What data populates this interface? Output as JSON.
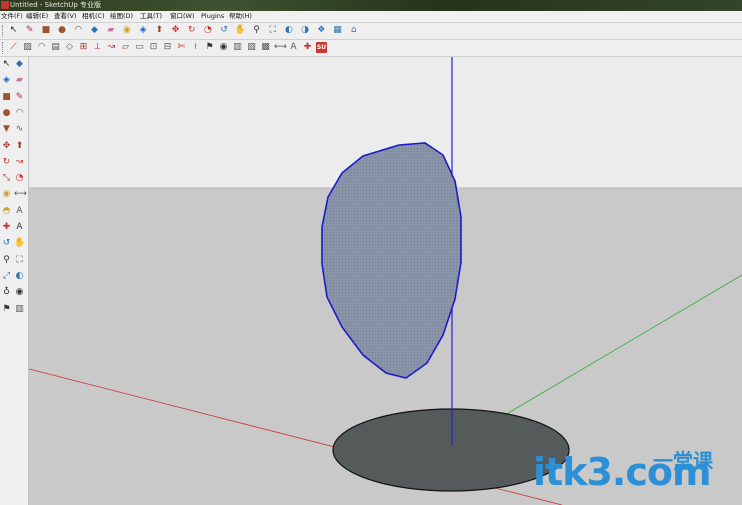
{
  "window": {
    "title": "Untitled - SketchUp 专业版"
  },
  "menu": [
    "文件(F)",
    "编辑(E)",
    "查看(V)",
    "相机(C)",
    "绘图(D)",
    "工具(T)",
    "窗口(W)",
    "Plugins",
    "帮助(H)"
  ],
  "toolbar_row1": [
    {
      "name": "select-arrow-icon",
      "glyph": "↖",
      "color": "#222222"
    },
    {
      "name": "pencil-line-icon",
      "glyph": "✎",
      "color": "#b03030"
    },
    {
      "name": "rectangle-icon",
      "glyph": "■",
      "color": "#a0522d"
    },
    {
      "name": "circle-icon",
      "glyph": "●",
      "color": "#a0522d"
    },
    {
      "name": "arc-icon",
      "glyph": "◠",
      "color": "#555555"
    },
    {
      "name": "make-component-icon",
      "glyph": "◆",
      "color": "#3070b0"
    },
    {
      "name": "eraser-icon",
      "glyph": "▰",
      "color": "#d070a0"
    },
    {
      "name": "tape-measure-icon",
      "glyph": "◉",
      "color": "#d0a030"
    },
    {
      "name": "paint-bucket-icon",
      "glyph": "◈",
      "color": "#2060c0"
    },
    {
      "name": "push-pull-icon",
      "glyph": "⬆",
      "color": "#a04020"
    },
    {
      "name": "move-icon",
      "glyph": "✥",
      "color": "#c03030"
    },
    {
      "name": "rotate-icon",
      "glyph": "↻",
      "color": "#c03030"
    },
    {
      "name": "offset-icon",
      "glyph": "◔",
      "color": "#c03030"
    },
    {
      "name": "orbit-icon",
      "glyph": "↺",
      "color": "#3070b0"
    },
    {
      "name": "pan-icon",
      "glyph": "✋",
      "color": "#3070b0"
    },
    {
      "name": "zoom-icon",
      "glyph": "⚲",
      "color": "#333333"
    },
    {
      "name": "zoom-extents-icon",
      "glyph": "⛶",
      "color": "#333333"
    },
    {
      "name": "previous-view-icon",
      "glyph": "◐",
      "color": "#3070b0"
    },
    {
      "name": "next-view-icon",
      "glyph": "◑",
      "color": "#3070b0"
    },
    {
      "name": "components-icon",
      "glyph": "❖",
      "color": "#3070b0"
    },
    {
      "name": "materials-icon",
      "glyph": "▦",
      "color": "#3070b0"
    },
    {
      "name": "warehouse-icon",
      "glyph": "⌂",
      "color": "#3070b0"
    }
  ],
  "toolbar_row2": [
    {
      "name": "sandbox-contours-icon",
      "glyph": "⟋",
      "color": "#b03030"
    },
    {
      "name": "sandbox-scratch-icon",
      "glyph": "▨",
      "color": "#555555"
    },
    {
      "name": "sandbox-smoove-icon",
      "glyph": "◠",
      "color": "#555555"
    },
    {
      "name": "sandbox-stamp-icon",
      "glyph": "▤",
      "color": "#555555"
    },
    {
      "name": "sandbox-drape-icon",
      "glyph": "◇",
      "color": "#555555"
    },
    {
      "name": "sandbox-add-detail-icon",
      "glyph": "⊞",
      "color": "#b03030"
    },
    {
      "name": "sandbox-flip-edge-icon",
      "glyph": "⟂",
      "color": "#b03030"
    },
    {
      "name": "follow-me-icon",
      "glyph": "↝",
      "color": "#b03030"
    },
    {
      "name": "intersect-icon",
      "glyph": "▱",
      "color": "#b03030"
    },
    {
      "name": "outer-shell-icon",
      "glyph": "▭",
      "color": "#555555"
    },
    {
      "name": "union-icon",
      "glyph": "⊡",
      "color": "#555555"
    },
    {
      "name": "subtract-icon",
      "glyph": "⊟",
      "color": "#555555"
    },
    {
      "name": "trim-icon",
      "glyph": "✄",
      "color": "#b03030"
    },
    {
      "name": "split-icon",
      "glyph": "⟊",
      "color": "#b03030"
    },
    {
      "name": "walk-icon",
      "glyph": "⚑",
      "color": "#333333"
    },
    {
      "name": "look-around-icon",
      "glyph": "◉",
      "color": "#333333"
    },
    {
      "name": "section-plane-icon",
      "glyph": "▥",
      "color": "#555555"
    },
    {
      "name": "section-cut-icon",
      "glyph": "▧",
      "color": "#555555"
    },
    {
      "name": "section-display-icon",
      "glyph": "▩",
      "color": "#555555"
    },
    {
      "name": "dimension-icon",
      "glyph": "⟷",
      "color": "#555555"
    },
    {
      "name": "text-label-icon",
      "glyph": "A",
      "color": "#555555"
    },
    {
      "name": "axes-icon",
      "glyph": "✚",
      "color": "#c03030"
    },
    {
      "name": "su-app-icon",
      "glyph": "SU",
      "color": "#ffffff",
      "bg": "#c8362d"
    }
  ],
  "side_toolbar": [
    {
      "name": "select-arrow-icon",
      "glyph": "↖",
      "color": "#222222"
    },
    {
      "name": "make-component-icon",
      "glyph": "◆",
      "color": "#3070b0"
    },
    {
      "name": "paint-bucket-icon",
      "glyph": "◈",
      "color": "#2060c0"
    },
    {
      "name": "eraser-icon",
      "glyph": "▰",
      "color": "#d070a0"
    },
    {
      "name": "rectangle-icon",
      "glyph": "■",
      "color": "#a0522d"
    },
    {
      "name": "pencil-line-icon",
      "glyph": "✎",
      "color": "#b03030"
    },
    {
      "name": "circle-icon",
      "glyph": "●",
      "color": "#a0522d"
    },
    {
      "name": "arc-icon",
      "glyph": "◠",
      "color": "#555555"
    },
    {
      "name": "polygon-icon",
      "glyph": "▼",
      "color": "#a0522d"
    },
    {
      "name": "freehand-icon",
      "glyph": "∿",
      "color": "#555555"
    },
    {
      "name": "move-icon",
      "glyph": "✥",
      "color": "#c03030"
    },
    {
      "name": "push-pull-icon",
      "glyph": "⬆",
      "color": "#a04020"
    },
    {
      "name": "rotate-icon",
      "glyph": "↻",
      "color": "#c03030"
    },
    {
      "name": "follow-me-icon",
      "glyph": "↝",
      "color": "#c03030"
    },
    {
      "name": "scale-icon",
      "glyph": "⤡",
      "color": "#c03030"
    },
    {
      "name": "offset-icon",
      "glyph": "◔",
      "color": "#c03030"
    },
    {
      "name": "tape-measure-icon",
      "glyph": "◉",
      "color": "#d0a030"
    },
    {
      "name": "dimension-icon",
      "glyph": "⟷",
      "color": "#555555"
    },
    {
      "name": "protractor-icon",
      "glyph": "◓",
      "color": "#d0a030"
    },
    {
      "name": "text-label-icon",
      "glyph": "A",
      "color": "#555555"
    },
    {
      "name": "axes-icon",
      "glyph": "✚",
      "color": "#c03030"
    },
    {
      "name": "3d-text-icon",
      "glyph": "A",
      "color": "#333333"
    },
    {
      "name": "orbit-icon",
      "glyph": "↺",
      "color": "#3070b0"
    },
    {
      "name": "pan-icon",
      "glyph": "✋",
      "color": "#3070b0"
    },
    {
      "name": "zoom-icon",
      "glyph": "⚲",
      "color": "#333333"
    },
    {
      "name": "zoom-window-icon",
      "glyph": "⛶",
      "color": "#333333"
    },
    {
      "name": "zoom-extents-icon",
      "glyph": "⤢",
      "color": "#3070b0"
    },
    {
      "name": "previous-view-icon",
      "glyph": "◐",
      "color": "#3070b0"
    },
    {
      "name": "position-camera-icon",
      "glyph": "♁",
      "color": "#333333"
    },
    {
      "name": "look-around-icon",
      "glyph": "◉",
      "color": "#333333"
    },
    {
      "name": "walk-icon",
      "glyph": "⚑",
      "color": "#333333"
    },
    {
      "name": "section-plane-icon",
      "glyph": "▥",
      "color": "#555555"
    }
  ],
  "scene": {
    "sky_color": "#ececec",
    "ground_color": "#c9c9c9",
    "horizon_color": "#b8b8b8",
    "ellipse_fill": "#8a94a8",
    "ellipse_edge": "#1a1acc",
    "disc_fill": "#555a5a",
    "disc_edge": "#111111",
    "axis_blue": "#2222cc",
    "axis_green": "#33aa33",
    "axis_red": "#cc3333"
  },
  "watermark": {
    "text": "itk3.com",
    "cn": "一堂课",
    "color": "#2d8fd6"
  }
}
